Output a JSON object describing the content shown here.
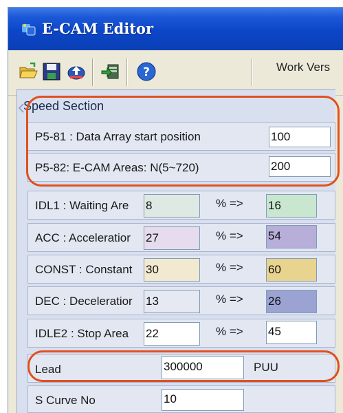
{
  "window": {
    "title": "E-CAM Editor"
  },
  "toolbar": {
    "buttons": [
      {
        "name": "open-folder-icon"
      },
      {
        "name": "save-icon"
      },
      {
        "name": "upload-icon"
      },
      {
        "name": "download-icon"
      },
      {
        "name": "help-icon"
      }
    ],
    "work_version_label": "Work Vers"
  },
  "speed_section": {
    "title": "Speed Section",
    "start_position": {
      "label": "P5-81 : Data Array start position",
      "value": "100"
    },
    "cam_areas": {
      "label": "P5-82: E-CAM Areas: N(5~720)",
      "value": "200"
    },
    "areas": [
      {
        "label": "IDL1 : Waiting Are",
        "percent": "8",
        "arrow": "% =>",
        "result": "16",
        "color": "#dfe9e3",
        "result_color": "#c9e7cf"
      },
      {
        "label": "ACC : Acceleratior",
        "percent": "27",
        "arrow": "% =>",
        "result": "54",
        "color": "#e6dcee",
        "result_color": "#b7aed9"
      },
      {
        "label": "CONST : Constant",
        "percent": "30",
        "arrow": "% =>",
        "result": "60",
        "color": "#f2ead0",
        "result_color": "#e9d48f"
      },
      {
        "label": "DEC : Deceleratior",
        "percent": "13",
        "arrow": "% =>",
        "result": "26",
        "color": "#e6e8f2",
        "result_color": "#9aa3d1"
      },
      {
        "label": "IDLE2 : Stop Area",
        "percent": "22",
        "arrow": "% =>",
        "result": "45",
        "color": "#ffffff",
        "result_color": "#ffffff"
      }
    ],
    "lead": {
      "label": "Lead",
      "value": "300000",
      "unit": "PUU"
    },
    "s_curve": {
      "label": "S Curve No",
      "value": "10"
    }
  },
  "colors": {
    "titlebar": "#0c46c8",
    "highlight": "#e0501e",
    "panel": "#d8dfef"
  }
}
